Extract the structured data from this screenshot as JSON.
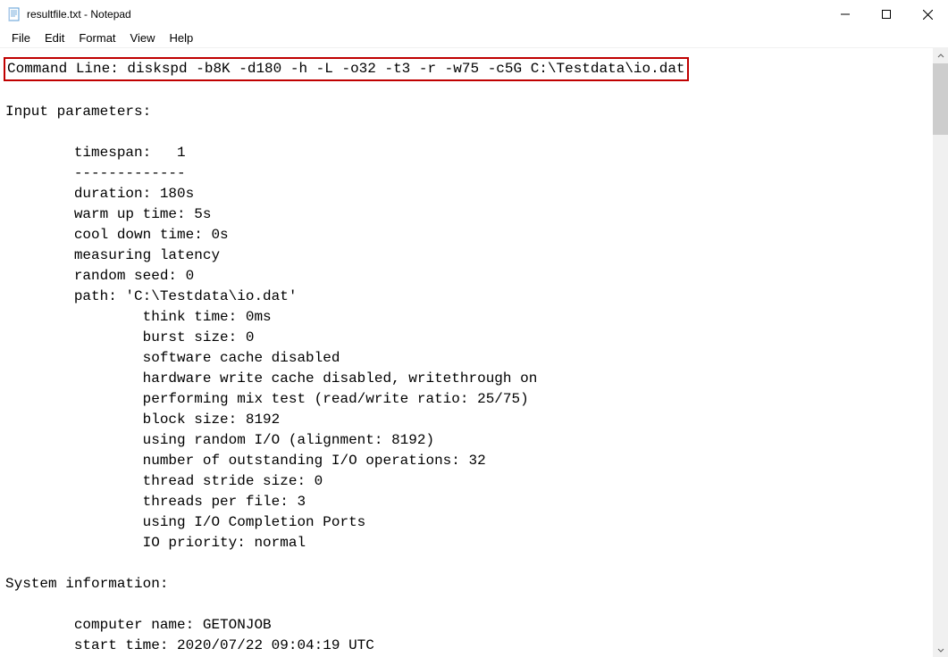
{
  "title": "resultfile.txt - Notepad",
  "menu": {
    "file": "File",
    "edit": "Edit",
    "format": "Format",
    "view": "View",
    "help": "Help"
  },
  "body": {
    "command_line": "Command Line: diskspd -b8K -d180 -h -L -o32 -t3 -r -w75 -c5G C:\\Testdata\\io.dat",
    "blank": "",
    "input_params_header": "Input parameters:",
    "timespan": "        timespan:   1",
    "dashes": "        -------------",
    "duration": "        duration: 180s",
    "warmup": "        warm up time: 5s",
    "cooldown": "        cool down time: 0s",
    "measuring": "        measuring latency",
    "seed": "        random seed: 0",
    "path": "        path: 'C:\\Testdata\\io.dat'",
    "think": "                think time: 0ms",
    "burst": "                burst size: 0",
    "softcache": "                software cache disabled",
    "hwcache": "                hardware write cache disabled, writethrough on",
    "mix": "                performing mix test (read/write ratio: 25/75)",
    "block": "                block size: 8192",
    "random": "                using random I/O (alignment: 8192)",
    "outstanding": "                number of outstanding I/O operations: 32",
    "stride": "                thread stride size: 0",
    "threads": "                threads per file: 3",
    "iocp": "                using I/O Completion Ports",
    "priority": "                IO priority: normal",
    "sysinfo_header": "System information:",
    "computer": "        computer name: GETONJOB",
    "start": "        start time: 2020/07/22 09:04:19 UTC"
  }
}
